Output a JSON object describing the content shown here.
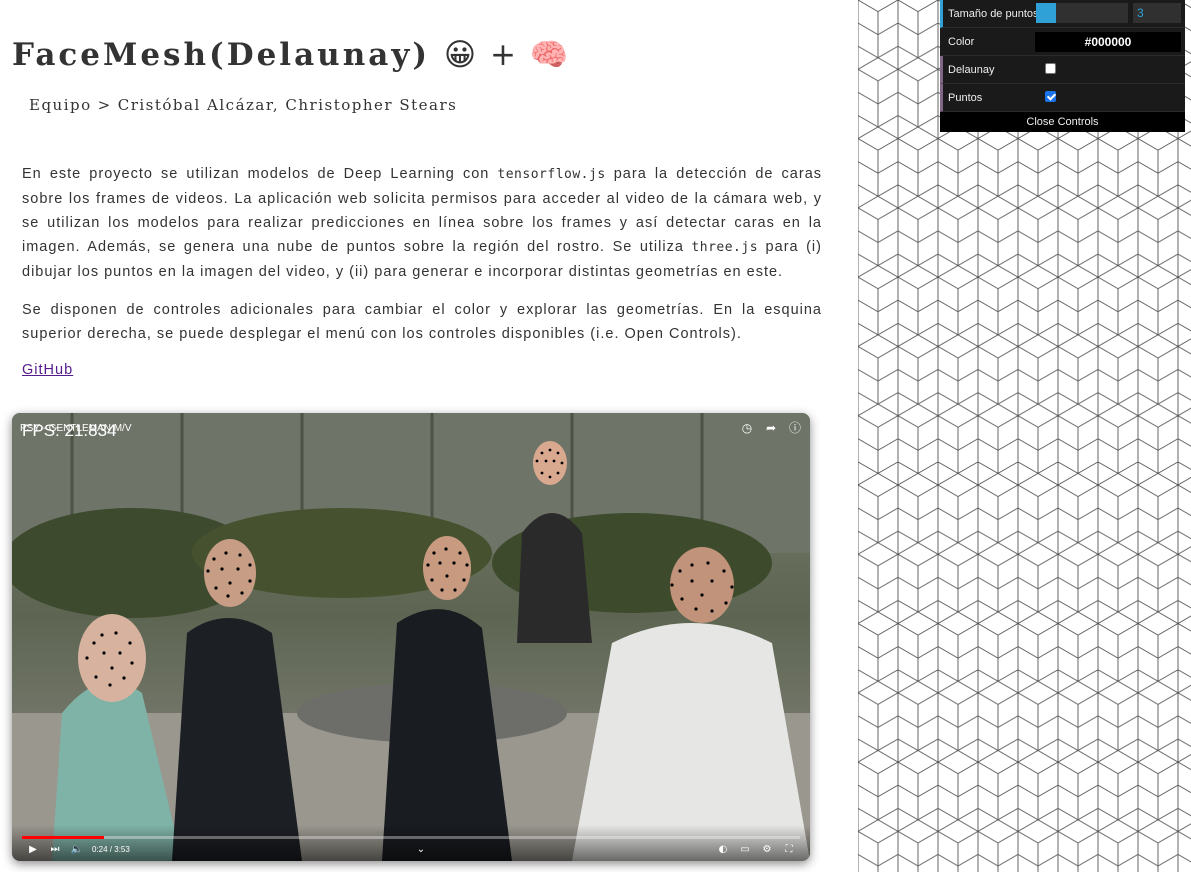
{
  "header": {
    "title": "FaceMesh(Delaunay)",
    "title_emoji_1": "😀",
    "plus": "+",
    "title_emoji_2": "🧠",
    "team_label": "Equipo",
    "team_sep": ">",
    "team_members": "Cristóbal Alcázar, Christopher Stears"
  },
  "content": {
    "p1_part1": "En este proyecto se utilizan modelos de Deep Learning con ",
    "p1_code1": "tensorflow.js",
    "p1_part2": " para la detección de caras sobre los frames de videos. La aplicación web solicita permisos para acceder al video de la cámara web, y se utilizan los modelos para realizar predicciones en línea sobre los frames y así detectar caras en la imagen. Además, se genera una nube de puntos sobre la región del rostro. Se utiliza ",
    "p1_code2": "three.js",
    "p1_part3": " para (i) dibujar los puntos en la imagen del video, y (ii) para generar e incorporar distintas geometrías en este.",
    "p2": "Se disponen de controles adicionales para cambiar el color y explorar las geometrías. En la esquina superior derecha, se puede desplegar el menú con los controles disponibles (i.e. Open Controls).",
    "github_link": "GitHub"
  },
  "video": {
    "title": "PSY - GENTLEMAN M/V",
    "fps": "FPS: 21.834",
    "time": "0:24 / 3:53",
    "progress": 0.105
  },
  "gui": {
    "point_size_label": "Tamaño de puntos",
    "point_size_value": "3",
    "point_size_fraction": 0.22,
    "color_label": "Color",
    "color_value": "#000000",
    "delaunay_label": "Delaunay",
    "delaunay_checked": false,
    "points_label": "Puntos",
    "points_checked": true,
    "close_label": "Close Controls"
  },
  "colors": {
    "accent": "#2fa1d6",
    "link": "#551a8b",
    "progress": "#ff0000"
  }
}
